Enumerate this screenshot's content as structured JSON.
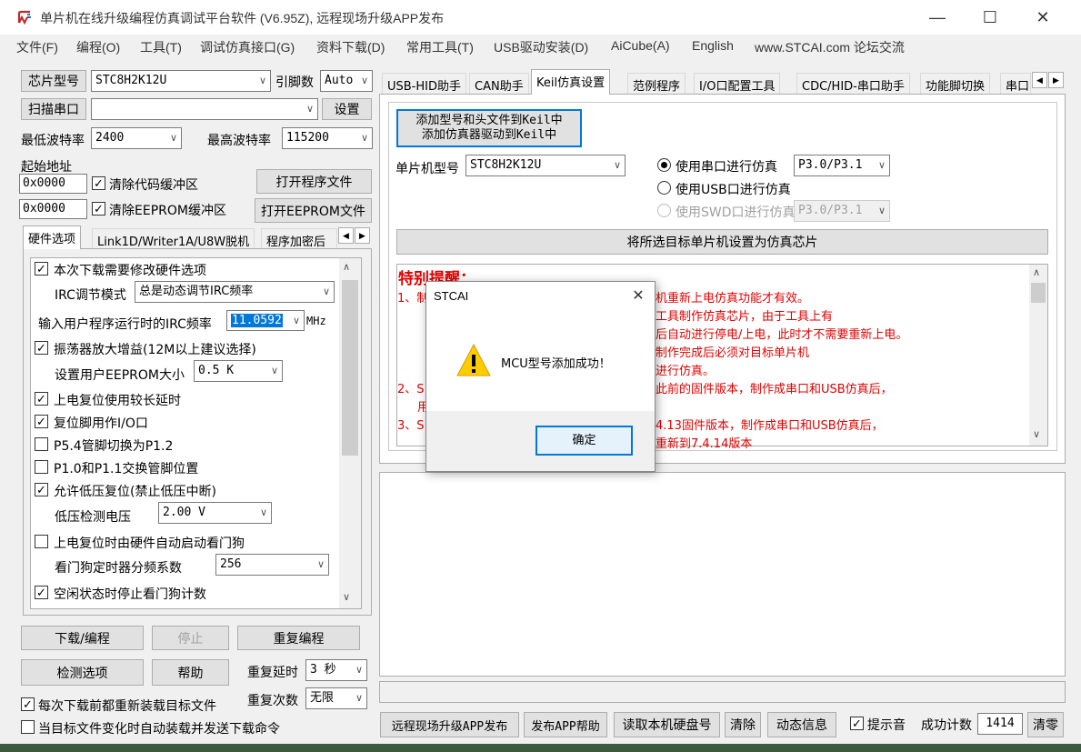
{
  "window": {
    "title": "单片机在线升级编程仿真调试平台软件 (V6.95Z), 远程现场升级APP发布"
  },
  "menu": [
    "文件(F)",
    "编程(O)",
    "工具(T)",
    "调试仿真接口(G)",
    "资料下载(D)",
    "常用工具(T)",
    "USB驱动安装(D)",
    "AiCube(A)",
    "English",
    "www.STCAI.com 论坛交流"
  ],
  "left": {
    "chip_type_btn": "芯片型号",
    "chip_type_value": "STC8H2K12U",
    "pin_count_label": "引脚数",
    "pin_count_value": "Auto",
    "scan_port_btn": "扫描串口",
    "settings_btn": "设置",
    "min_baud_label": "最低波特率",
    "min_baud_value": "2400",
    "max_baud_label": "最高波特率",
    "max_baud_value": "115200",
    "start_addr_label": "起始地址",
    "addr1": "0x0000",
    "clear_code_label": "清除代码缓冲区",
    "open_prog_btn": "打开程序文件",
    "addr2": "0x0000",
    "clear_eeprom_label": "清除EEPROM缓冲区",
    "open_eeprom_btn": "打开EEPROM文件",
    "tabs": [
      "硬件选项",
      "Link1D/Writer1A/U8W脱机",
      "程序加密后"
    ],
    "options": {
      "modify_hw": "本次下载需要修改硬件选项",
      "irc_mode_label": "IRC调节模式",
      "irc_mode_value": "总是动态调节IRC频率",
      "irc_freq_label": "输入用户程序运行时的IRC频率",
      "irc_freq_value": "11.0592",
      "irc_freq_unit": "MHz",
      "osc_gain": "振荡器放大增益(12M以上建议选择)",
      "eeprom_size_label": "设置用户EEPROM大小",
      "eeprom_size_value": "0.5 K",
      "long_reset": "上电复位使用较长延时",
      "reset_io": "复位脚用作I/O口",
      "p54": "P5.4管脚切换为P1.2",
      "p10": "P1.0和P1.1交换管脚位置",
      "low_volt_reset": "允许低压复位(禁止低压中断)",
      "low_volt_label": "低压检测电压",
      "low_volt_value": "2.00 V",
      "wdt_auto": "上电复位时由硬件自动启动看门狗",
      "wdt_div_label": "看门狗定时器分频系数",
      "wdt_div_value": "256",
      "wdt_idle": "空闲状态时停止看门狗计数"
    },
    "download_btn": "下载/编程",
    "stop_btn": "停止",
    "reprogram_btn": "重复编程",
    "check_btn": "检测选项",
    "help_btn": "帮助",
    "repeat_delay_label": "重复延时",
    "repeat_delay_value": "3 秒",
    "repeat_count_label": "重复次数",
    "repeat_count_value": "无限",
    "reload_label": "每次下载前都重新装载目标文件",
    "auto_send_label": "当目标文件变化时自动装载并发送下载命令"
  },
  "right": {
    "tabs": [
      "USB-HID助手",
      "CAN助手",
      "Keil仿真设置",
      "范例程序",
      "I/O口配置工具",
      "CDC/HID-串口助手",
      "功能脚切换",
      "串口"
    ],
    "add_keil_btn_line1": "添加型号和头文件到Keil中",
    "add_keil_btn_line2": "添加仿真器驱动到Keil中",
    "mcu_type_label": "单片机型号",
    "mcu_type_value": "STC8H2K12U",
    "radio_uart": "使用串口进行仿真",
    "uart_pins": "P3.0/P3.1",
    "radio_usb": "使用USB口进行仿真",
    "radio_swd": "使用SWD口进行仿真",
    "swd_pins": "P3.0/P3.1",
    "set_chip_btn": "将所选目标单片机设置为仿真芯片",
    "notice_title": "特别提醒：",
    "notice_lines": [
      "1、制",
      "机重新上电仿真功能才有效。",
      "工具制作仿真芯片，由于工具上有",
      "后自动进行停电/上电，此时才不需要重新上电。",
      "制作完成后必须对目标单片机",
      "进行仿真。",
      "2、S",
      "此前的固件版本，制作成串口和USB仿真后，",
      "用",
      "3、S",
      "4.13固件版本，制作成串口和USB仿真后，",
      "重新到7.4.14版本"
    ],
    "bottom_buttons": [
      "远程现场升级APP发布",
      "发布APP帮助",
      "读取本机硬盘号",
      "清除",
      "动态信息"
    ],
    "beep_label": "提示音",
    "success_label": "成功计数",
    "success_count": "1414",
    "clear_count_btn": "清零"
  },
  "dialog": {
    "title": "STCAI",
    "message": "MCU型号添加成功！",
    "ok_btn": "确定"
  }
}
